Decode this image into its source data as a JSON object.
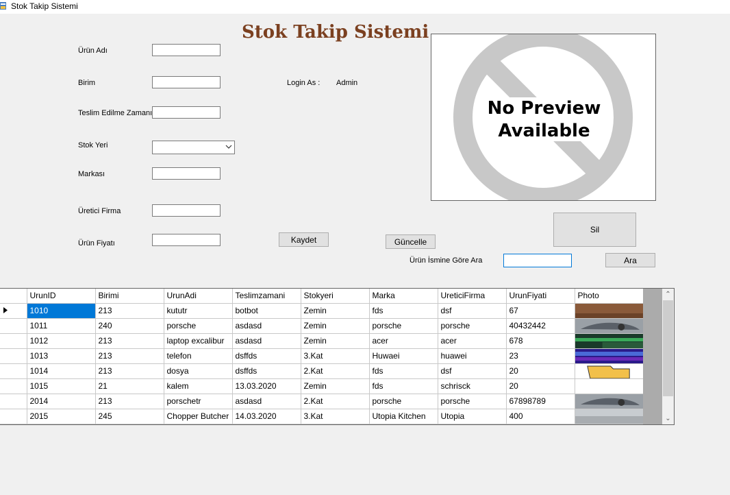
{
  "window": {
    "title": "Stok Takip Sistemi"
  },
  "header": {
    "title": "Stok Takip Sistemi"
  },
  "form": {
    "urun_adi_label": "Ürün Adı",
    "birim_label": "Birim",
    "teslim_label": "Teslim Edilme Zamanı",
    "stok_yeri_label": "Stok Yeri",
    "markasi_label": "Markası",
    "uretici_label": "Üretici Firma",
    "fiyat_label": "Ürün Fiyatı"
  },
  "login": {
    "label": "Login As :",
    "user": "Admin"
  },
  "buttons": {
    "kaydet": "Kaydet",
    "guncelle": "Güncelle",
    "sil": "Sil",
    "ara": "Ara"
  },
  "search": {
    "label": "Ürün İsmine Göre Ara",
    "value": ""
  },
  "preview": {
    "line1": "No Preview",
    "line2": "Available"
  },
  "table": {
    "columns": [
      "UrunID",
      "Birimi",
      "UrunAdi",
      "Teslimzamani",
      "Stokyeri",
      "Marka",
      "UreticiFirma",
      "UrunFiyati",
      "Photo"
    ],
    "rows": [
      {
        "cells": [
          "1010",
          "213",
          "kututr",
          "botbot",
          "Zemin",
          "fds",
          "dsf",
          "67"
        ],
        "photo": "brown"
      },
      {
        "cells": [
          "1011",
          "240",
          "porsche",
          "asdasd",
          "Zemin",
          "porsche",
          "porsche",
          "40432442"
        ],
        "photo": "car"
      },
      {
        "cells": [
          "1012",
          "213",
          "laptop excalibur",
          "asdasd",
          "Zemin",
          "acer",
          "acer",
          "678"
        ],
        "photo": "green"
      },
      {
        "cells": [
          "1013",
          "213",
          "telefon",
          "dsffds",
          "3.Kat",
          "Huwaei",
          "huawei",
          "23"
        ],
        "photo": "blue"
      },
      {
        "cells": [
          "1014",
          "213",
          "dosya",
          "dsffds",
          "2.Kat",
          "fds",
          "dsf",
          "20"
        ],
        "photo": "folder"
      },
      {
        "cells": [
          "1015",
          "21",
          "kalem",
          "13.03.2020",
          "Zemin",
          "fds",
          "schrisck",
          "20"
        ],
        "photo": "none"
      },
      {
        "cells": [
          "2014",
          "213",
          "porschetr",
          "asdasd",
          "2.Kat",
          "porsche",
          "porsche",
          "67898789"
        ],
        "photo": "car"
      },
      {
        "cells": [
          "2015",
          "245",
          "Chopper Butcher",
          "14.03.2020",
          "3.Kat",
          "Utopia Kitchen",
          "Utopia",
          "400"
        ],
        "photo": "gray"
      }
    ]
  },
  "colors": {
    "title": "#7b4020",
    "selection": "#0078d7"
  }
}
